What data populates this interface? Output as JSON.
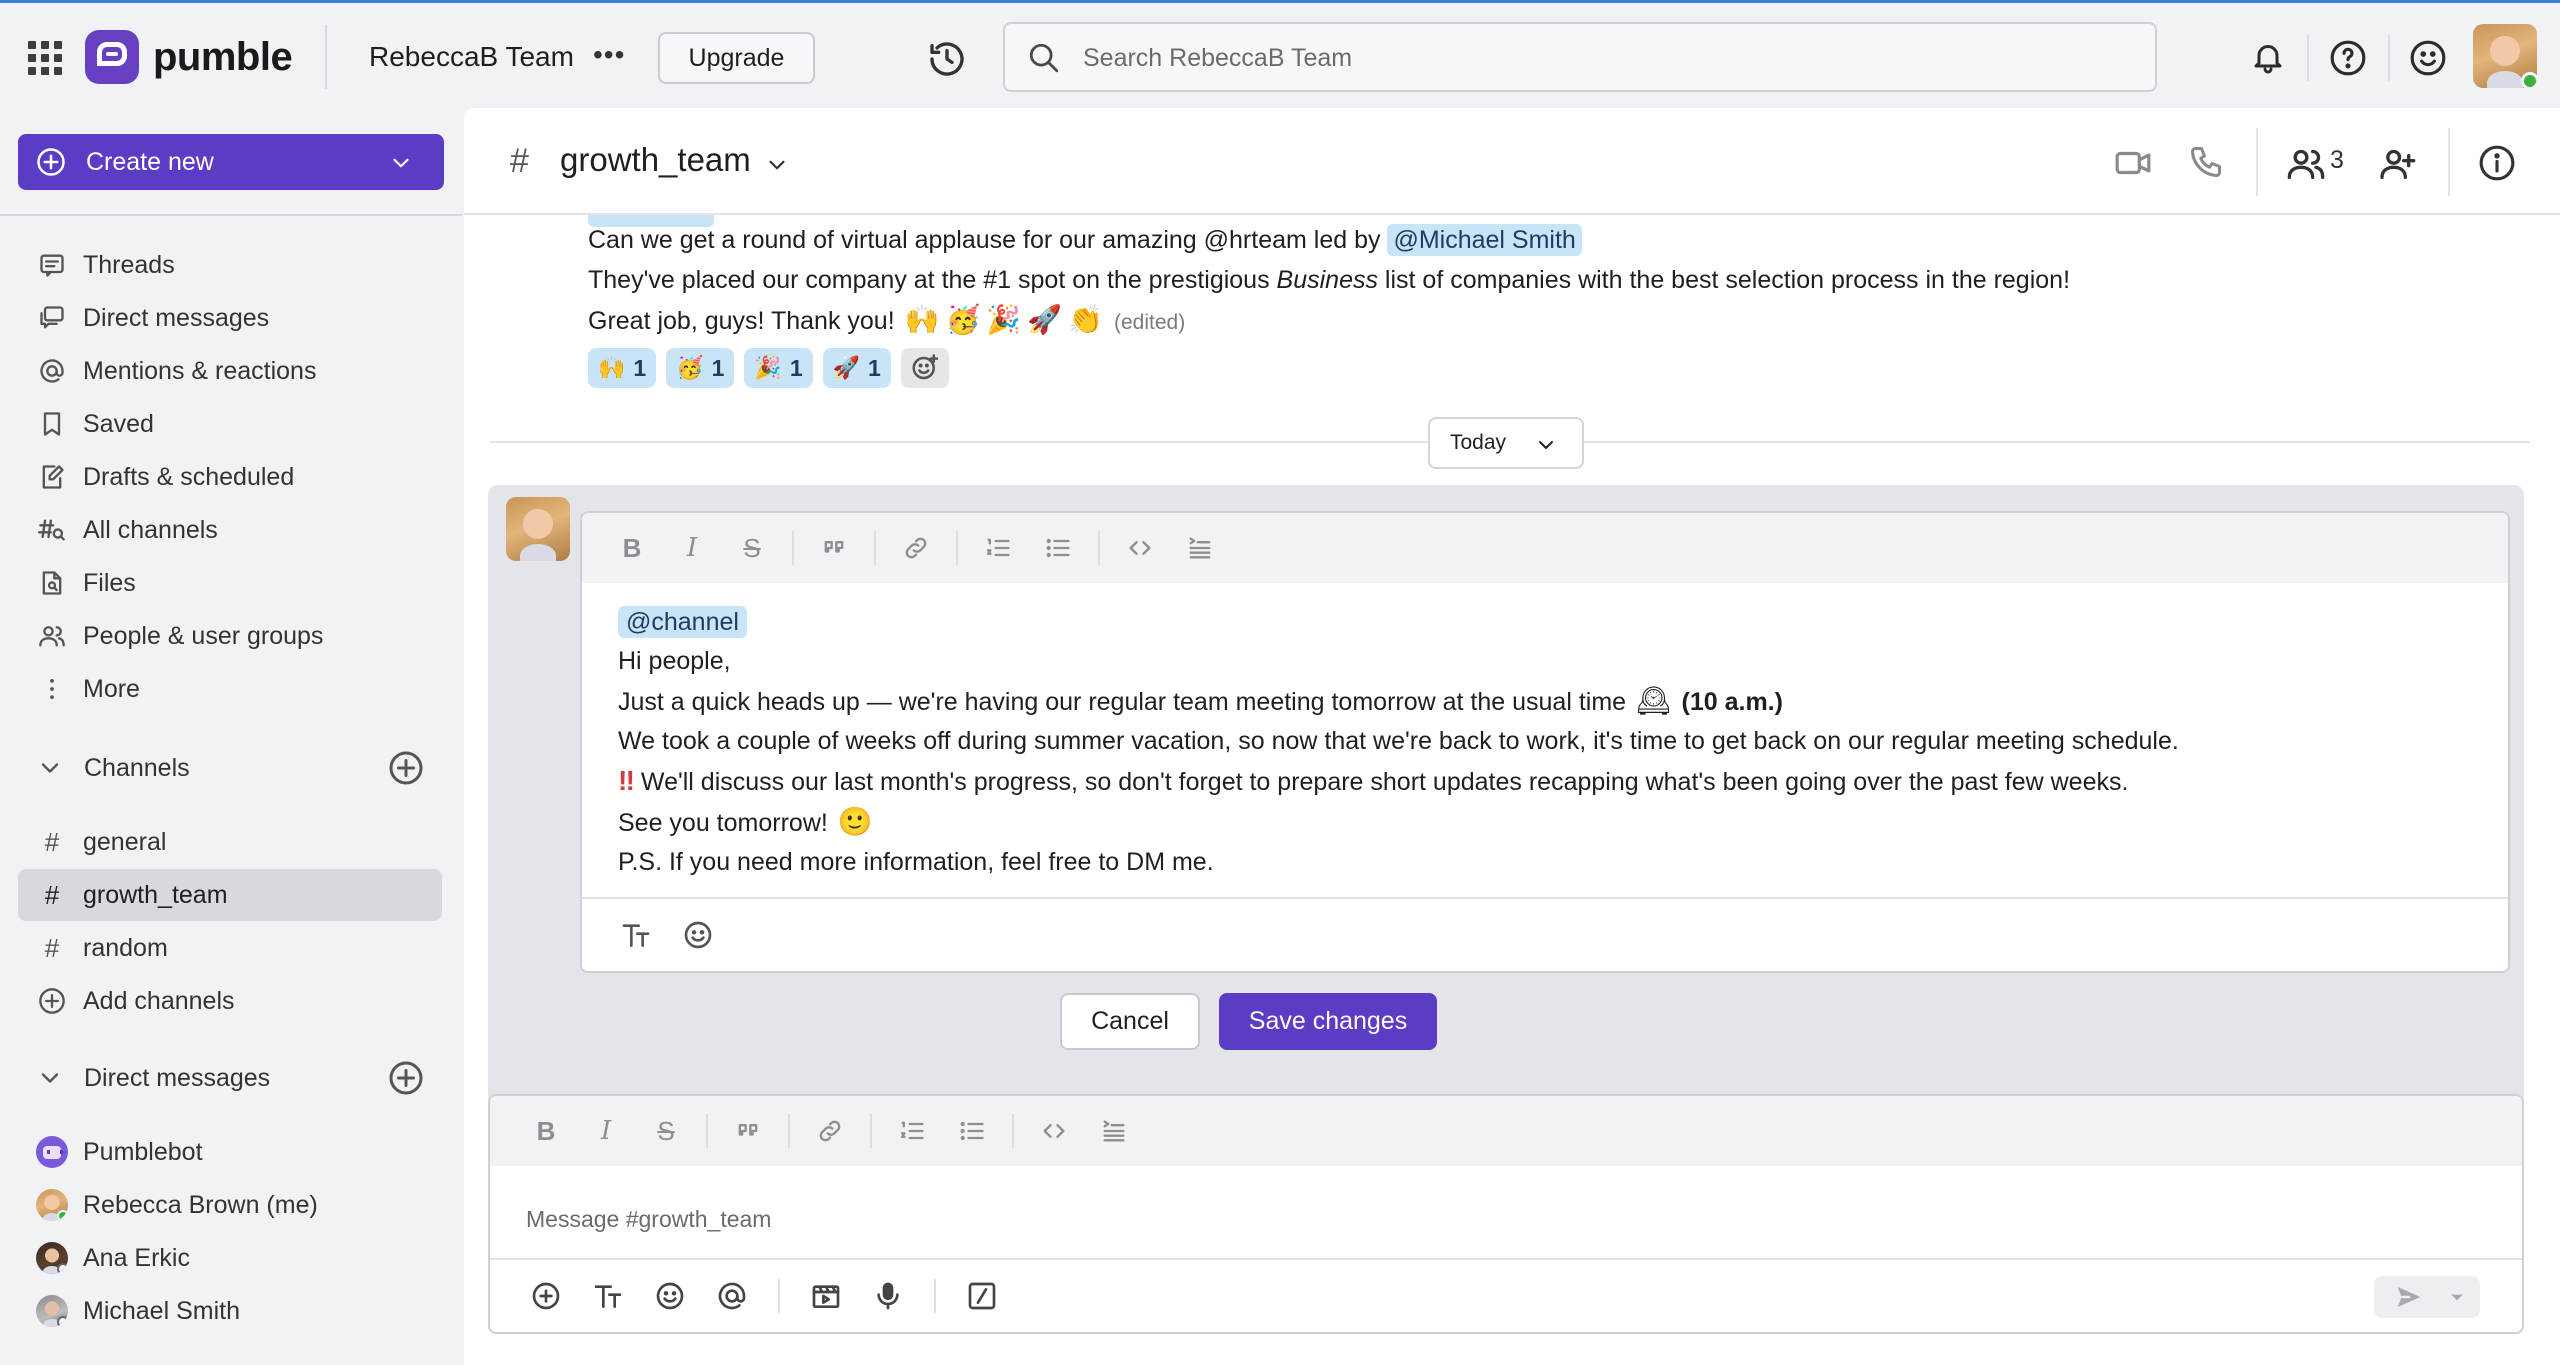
{
  "topbar": {
    "logo_text": "pumble",
    "team_name": "RebeccaB Team",
    "team_menu": "•••",
    "upgrade_label": "Upgrade",
    "search_placeholder": "Search RebeccaB Team"
  },
  "sidebar": {
    "create_label": "Create new",
    "nav": [
      {
        "label": "Threads",
        "icon": "threads-icon"
      },
      {
        "label": "Direct messages",
        "icon": "direct-messages-icon"
      },
      {
        "label": "Mentions & reactions",
        "icon": "at-icon"
      },
      {
        "label": "Saved",
        "icon": "bookmark-icon"
      },
      {
        "label": "Drafts & scheduled",
        "icon": "drafts-icon"
      },
      {
        "label": "All channels",
        "icon": "channel-search-icon"
      },
      {
        "label": "Files",
        "icon": "files-icon"
      },
      {
        "label": "People & user groups",
        "icon": "people-icon"
      },
      {
        "label": "More",
        "icon": "more-vertical-icon"
      }
    ],
    "channels_title": "Channels",
    "channels": [
      {
        "label": "general"
      },
      {
        "label": "growth_team",
        "active": true
      },
      {
        "label": "random"
      }
    ],
    "add_channels_label": "Add channels",
    "dms_title": "Direct messages",
    "dms": [
      {
        "label": "Pumblebot"
      },
      {
        "label": "Rebecca Brown (me)"
      },
      {
        "label": "Ana Erkic"
      },
      {
        "label": "Michael Smith"
      }
    ]
  },
  "channel": {
    "name": "growth_team",
    "member_count": "3"
  },
  "message": {
    "line1_text": "Can we get a round of virtual applause for our amazing @hrteam led by ",
    "line1_mention": "@Michael Smith",
    "line2_before": "They've placed our company at the #1 spot on the prestigious ",
    "line2_italic": "Business",
    "line2_after": " list of companies with the best selection process in the region!",
    "line3_text": "Great job, guys! Thank you! ",
    "line3_emojis": [
      "🙌",
      "🥳",
      "🎉",
      "🚀",
      "👏"
    ],
    "edited_label": "(edited)",
    "reactions": [
      {
        "emoji": "🙌",
        "count": "1"
      },
      {
        "emoji": "🥳",
        "count": "1"
      },
      {
        "emoji": "🎉",
        "count": "1"
      },
      {
        "emoji": "🚀",
        "count": "1"
      }
    ]
  },
  "day_divider": {
    "label": "Today"
  },
  "edit": {
    "mention": "@channel",
    "greeting": "Hi people,",
    "line_heads_up_before": "Just a quick heads up — we're having our regular team meeting tomorrow at the usual time ",
    "line_heads_up_emoji": "🕰",
    "line_heads_up_bold": "(10 a.m.)",
    "line_vacation": "We took a couple of weeks off during summer vacation, so now that we're back to work, it's time to get back on our regular meeting schedule.",
    "line_discuss_mark": "‼",
    "line_discuss": "We'll discuss our last month's progress, so don't forget to prepare short updates recapping what's been going over the past few weeks.",
    "line_see_you": "See you tomorrow! ",
    "line_see_you_emoji": "🙂",
    "line_ps": "P.S. If you need more information, feel free to DM me.",
    "cancel_label": "Cancel",
    "save_label": "Save changes"
  },
  "composer": {
    "placeholder": "Message #growth_team"
  },
  "colors": {
    "brand": "#5b3cc4",
    "mention_bg": "#c9e3f7",
    "online": "#3cb043"
  }
}
